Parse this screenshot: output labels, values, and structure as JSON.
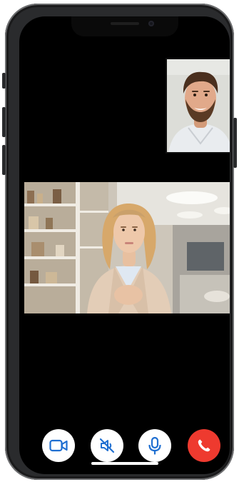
{
  "call": {
    "self_participant": {
      "avatar": "man-portrait"
    },
    "remote_participant": {
      "avatar": "woman-portrait"
    },
    "controls": [
      {
        "icon": "video-camera-icon"
      },
      {
        "icon": "speaker-muted-icon"
      },
      {
        "icon": "microphone-icon"
      },
      {
        "icon": "end-call-icon",
        "color": "#ee3a2f"
      }
    ],
    "control_icon_color": "#1f6fd1"
  }
}
